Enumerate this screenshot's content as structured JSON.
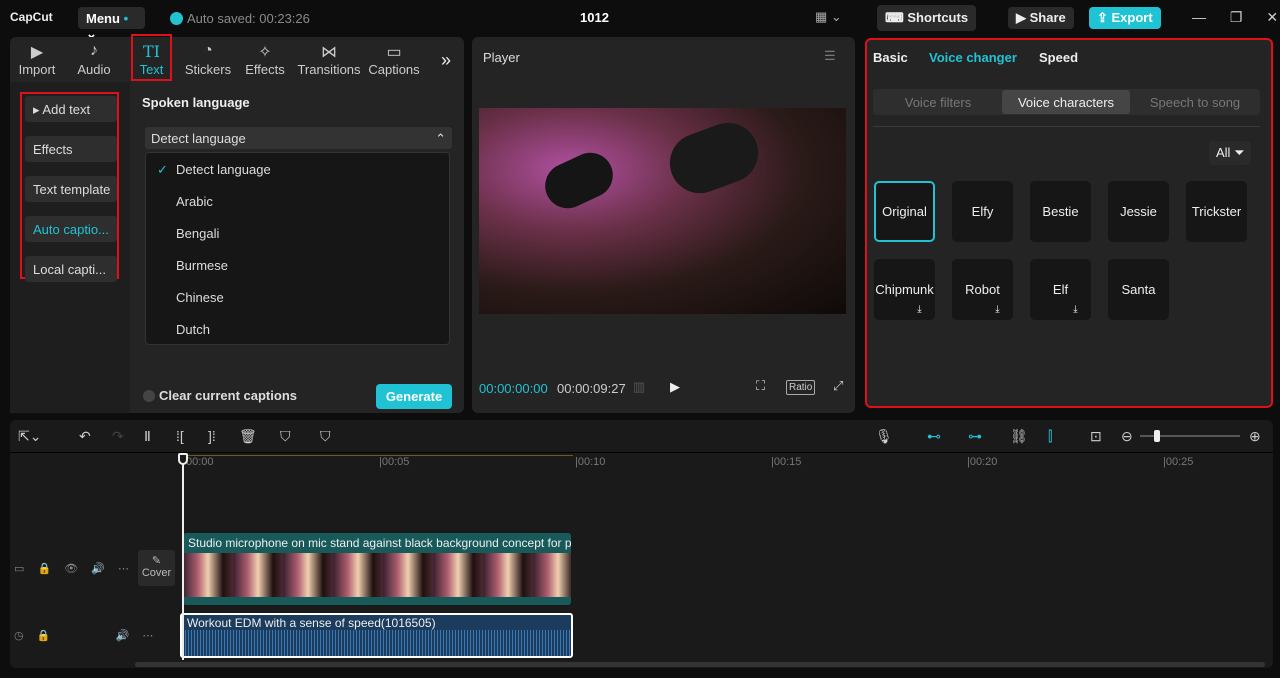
{
  "app": {
    "logo": "CapCut",
    "menu": "Menu",
    "autosave": "Auto saved: 00:23:26",
    "title": "1012",
    "shortcuts": "Shortcuts",
    "share": "Share",
    "export": "Export"
  },
  "tabs": [
    {
      "label": "Import",
      "icon": "▶"
    },
    {
      "label": "Audio",
      "icon": "♪"
    },
    {
      "label": "Text",
      "icon": "TI"
    },
    {
      "label": "Stickers",
      "icon": "◔"
    },
    {
      "label": "Effects",
      "icon": "✧"
    },
    {
      "label": "Transitions",
      "icon": "⋈"
    },
    {
      "label": "Captions",
      "icon": "▭"
    }
  ],
  "sidebar": [
    "Add text",
    "Effects",
    "Text template",
    "Auto captio...",
    "Local capti..."
  ],
  "captions": {
    "heading": "Spoken language",
    "selected": "Detect language",
    "options": [
      "Detect language",
      "Arabic",
      "Bengali",
      "Burmese",
      "Chinese",
      "Dutch"
    ],
    "clear": "Clear current captions",
    "generate": "Generate"
  },
  "player": {
    "title": "Player",
    "current": "00:00:00:00",
    "total": "00:00:09:27",
    "ratio": "Ratio"
  },
  "right": {
    "tabs": [
      "Basic",
      "Voice changer",
      "Speed"
    ],
    "segments": [
      "Voice filters",
      "Voice characters",
      "Speech to song"
    ],
    "filter": "All",
    "voices": [
      "Original",
      "Elfy",
      "Bestie",
      "Jessie",
      "Trickster",
      "Chipmunk",
      "Robot",
      "Elf",
      "Santa"
    ]
  },
  "timeline": {
    "ticks": [
      "00:00",
      "|00:05",
      "|00:10",
      "|00:15",
      "|00:20",
      "|00:25"
    ],
    "video_clip": "Studio microphone on mic stand against black background concept for p",
    "audio_clip": "Workout EDM with a sense of speed(1016505)",
    "cover": "Cover"
  },
  "colors": {
    "accent": "#1fc3d4",
    "highlight": "#e0101b"
  }
}
